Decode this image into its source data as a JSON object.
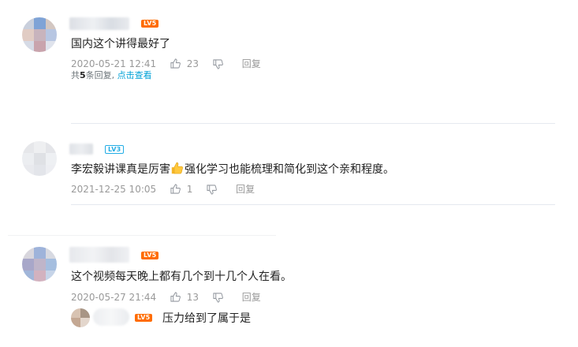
{
  "comments": [
    {
      "level": "LV5",
      "text": "国内这个讲得最好了",
      "time": "2020-05-21 12:41",
      "likes": "23",
      "reply_label": "回复",
      "replies_prefix": "共",
      "replies_count": "5",
      "replies_suffix": "条回复,",
      "replies_link": "点击查看"
    },
    {
      "level": "LV3",
      "text_before": "李宏毅讲课真是厉害",
      "emoji": "thumbs-up-emoji",
      "text_after": "强化学习也能梳理和简化到这个亲和程度。",
      "time": "2021-12-25 10:05",
      "likes": "1",
      "reply_label": "回复"
    },
    {
      "level": "LV5",
      "text": "这个视频每天晚上都有几个到十几个人在看。",
      "time": "2020-05-27 21:44",
      "likes": "13",
      "reply_label": "回复",
      "sub_reply": {
        "level": "LV5",
        "text": "压力给到了属于是"
      }
    }
  ],
  "colors": {
    "level_orange": "#ff6c00",
    "level_blue": "#23ade5",
    "link": "#00a1d6",
    "meta": "#999999",
    "divider": "#e5e9ef"
  }
}
